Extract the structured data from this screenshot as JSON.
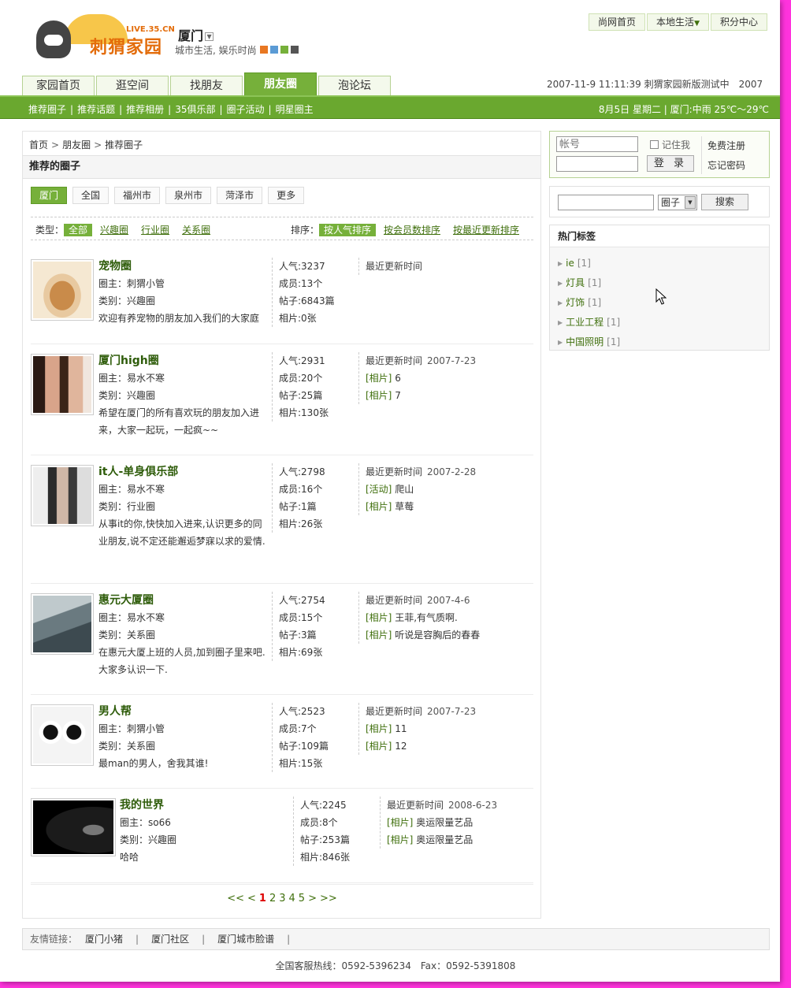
{
  "logo": {
    "site": "LIVE.35.CN",
    "name": "刺猬家园"
  },
  "city": {
    "name": "厦门",
    "slogan": "城市生活, 娱乐时尚"
  },
  "theme_swatches": [
    "#e87722",
    "#5b9bd5",
    "#76b03a",
    "#555555"
  ],
  "topnav": {
    "home": "尚网首页",
    "local": "本地生活",
    "points": "积分中心"
  },
  "mainnav": [
    "家园首页",
    "逛空间",
    "找朋友",
    "朋友圈",
    "泡论坛"
  ],
  "mainnav_active": 3,
  "datetime_text": "2007-11-9 11:11:39 刺猬家园新版测试中　2007",
  "subnav": [
    "推荐圈子",
    "推荐话题",
    "推荐相册",
    "35俱乐部",
    "圈子活动",
    "明星圈主"
  ],
  "weather": "8月5日 星期二 | 厦门:中雨 25℃～29℃",
  "breadcrumb": [
    "首页",
    "朋友圈",
    "推荐圈子"
  ],
  "section_title": "推荐的圈子",
  "cities": [
    "厦门",
    "全国",
    "福州市",
    "泉州市",
    "菏泽市",
    "更多"
  ],
  "filters": {
    "type_label": "类型：",
    "types": [
      "全部",
      "兴趣圈",
      "行业圈",
      "关系圈"
    ],
    "sort_label": "排序：",
    "sorts": [
      "按人气排序",
      "按会员数排序",
      "按最近更新排序"
    ]
  },
  "circles": [
    {
      "name": "宠物圈",
      "owner": "圈主：刺猬小管",
      "category": "类别：兴趣圈",
      "desc": "欢迎有养宠物的朋友加入我们的大家庭",
      "stats": [
        "人气:3237",
        "成员:13个",
        "帖子:6843篇",
        "相片:0张"
      ],
      "recent_label": "最近更新时间",
      "recent_date": "",
      "updates": []
    },
    {
      "name": "厦门high圈",
      "owner": "圈主：易水不寒",
      "category": "类别：兴趣圈",
      "desc": "希望在厦门的所有喜欢玩的朋友加入进来，大家一起玩，一起疯~~",
      "stats": [
        "人气:2931",
        "成员:20个",
        "帖子:25篇",
        "相片:130张"
      ],
      "recent_label": "最近更新时间",
      "recent_date": "2007-7-23",
      "updates": [
        {
          "tag": "[相片]",
          "text": "6"
        },
        {
          "tag": "[相片]",
          "text": "7"
        }
      ]
    },
    {
      "name": "it人-单身俱乐部",
      "owner": "圈主：易水不寒",
      "category": "类别：行业圈",
      "desc": "从事it的你,快快加入进来,认识更多的同业朋友,说不定还能邂逅梦寐以求的爱情.",
      "stats": [
        "人气:2798",
        "成员:16个",
        "帖子:1篇",
        "相片:26张"
      ],
      "recent_label": "最近更新时间",
      "recent_date": "2007-2-28",
      "updates": [
        {
          "tag": "[活动]",
          "text": "爬山"
        },
        {
          "tag": "[相片]",
          "text": "草莓"
        }
      ]
    },
    {
      "name": "惠元大厦圈",
      "owner": "圈主：易水不寒",
      "category": "类别：关系圈",
      "desc": "在惠元大厦上班的人员,加到圈子里来吧.大家多认识一下.",
      "stats": [
        "人气:2754",
        "成员:15个",
        "帖子:3篇",
        "相片:69张"
      ],
      "recent_label": "最近更新时间",
      "recent_date": "2007-4-6",
      "updates": [
        {
          "tag": "[相片]",
          "text": "王菲,有气质啊."
        },
        {
          "tag": "[相片]",
          "text": "听说是容胸后的春春"
        }
      ]
    },
    {
      "name": "男人帮",
      "owner": "圈主：刺猬小管",
      "category": "类别：关系圈",
      "desc": "最man的男人，舍我其谁!",
      "stats": [
        "人气:2523",
        "成员:7个",
        "帖子:109篇",
        "相片:15张"
      ],
      "recent_label": "最近更新时间",
      "recent_date": "2007-7-23",
      "updates": [
        {
          "tag": "[相片]",
          "text": "11"
        },
        {
          "tag": "[相片]",
          "text": "12"
        }
      ]
    },
    {
      "name": "我的世界",
      "owner": "圈主：so66",
      "category": "类别：兴趣圈",
      "desc": "哈哈",
      "stats": [
        "人气:2245",
        "成员:8个",
        "帖子:253篇",
        "相片:846张"
      ],
      "recent_label": "最近更新时间",
      "recent_date": "2008-6-23",
      "updates": [
        {
          "tag": "[相片]",
          "text": "奥运限量艺品"
        },
        {
          "tag": "[相片]",
          "text": "奥运限量艺品"
        }
      ]
    }
  ],
  "pager": {
    "first": "<<",
    "prev": "<",
    "pages": [
      "1",
      "2",
      "3",
      "4",
      "5"
    ],
    "current": "1",
    "next": ">",
    "last": ">>"
  },
  "login": {
    "user_placeholder": "帐号",
    "remember": "记住我",
    "button": "登 录",
    "register": "免费注册",
    "forgot": "忘记密码"
  },
  "search": {
    "scope": "圈子",
    "button": "搜索"
  },
  "hot_tags": {
    "title": "热门标签",
    "items": [
      {
        "name": "ie",
        "count": "[1]"
      },
      {
        "name": "灯具",
        "count": "[1]"
      },
      {
        "name": "灯饰",
        "count": "[1]"
      },
      {
        "name": "工业工程",
        "count": "[1]"
      },
      {
        "name": "中国照明",
        "count": "[1]"
      }
    ]
  },
  "friendlinks": {
    "label": "友情链接：",
    "links": [
      "厦门小猪",
      "厦门社区",
      "厦门城市脸谱"
    ]
  },
  "hotline": "全国客服热线：0592-5396234　Fax：0592-5391808"
}
